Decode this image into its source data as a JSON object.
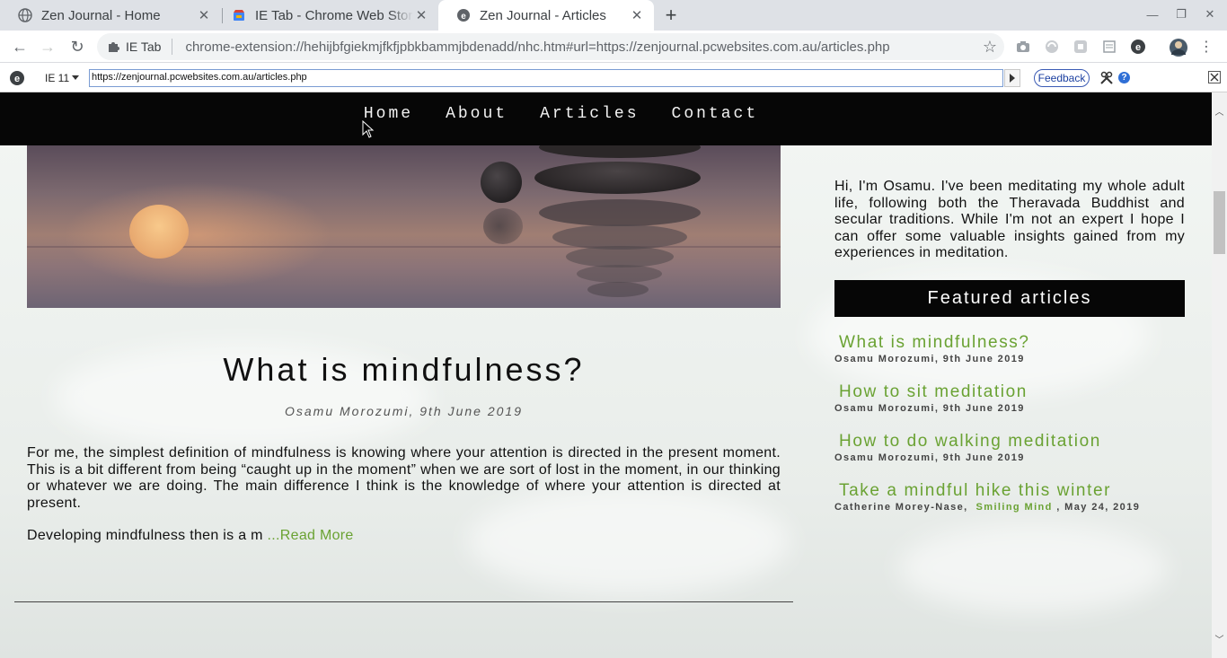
{
  "browser": {
    "tabs": [
      {
        "title": "Zen Journal - Home",
        "active": false
      },
      {
        "title": "IE Tab - Chrome Web Store",
        "active": false
      },
      {
        "title": "Zen Journal - Articles",
        "active": true
      }
    ],
    "new_tab": "+",
    "omnibox": {
      "extension_label": "IE Tab",
      "url": "chrome-extension://hehijbfgiekmjfkfjpbkbammjbdenadd/nhc.htm#url=https://zenjournal.pcwebsites.com.au/articles.php"
    }
  },
  "ietab": {
    "version": "IE 11",
    "url": "https://zenjournal.pcwebsites.com.au/articles.php",
    "feedback_label": "Feedback",
    "help_label": "?"
  },
  "site": {
    "nav": [
      "Home",
      "About",
      "Articles",
      "Contact"
    ],
    "post": {
      "title": "What is mindfulness?",
      "meta": "Osamu Morozumi, 9th June 2019",
      "body": "For me, the simplest definition of mindfulness is knowing where your attention is directed in the present moment. This is a bit different from being “caught up in the moment” when we are sort of lost in the moment, in our thinking or whatever we are doing. The main difference I think is the knowledge of where your attention is directed at present.",
      "excerpt": "Developing mindfulness then is a m ",
      "read_more": "...Read More"
    },
    "sidebar": {
      "bio": "Hi, I'm Osamu. I've been meditating my whole adult life, following both the Theravada Buddhist and secular traditions. While I'm not an expert I hope I can offer some valuable insights gained from my experiences in meditation.",
      "featured_heading": "Featured articles",
      "featured": [
        {
          "title": "What is mindfulness?",
          "meta": "Osamu Morozumi, 9th June 2019"
        },
        {
          "title": "How to sit meditation",
          "meta": "Osamu Morozumi, 9th June 2019"
        },
        {
          "title": "How to do walking meditation",
          "meta": "Osamu Morozumi, 9th June 2019"
        },
        {
          "title": "Take a mindful hike this winter",
          "meta_author": "Catherine Morey-Nase,",
          "meta_source": "Smiling Mind",
          "meta_date": ", May 24, 2019"
        }
      ]
    }
  },
  "colors": {
    "accent_green": "#6aa233",
    "nav_bg": "#060606",
    "tabstrip_bg": "#dee1e6"
  },
  "icons": [
    "globe-icon",
    "chrome-store-icon",
    "ie-tab-icon",
    "close-icon",
    "plus-icon",
    "back-icon",
    "forward-icon",
    "reload-icon",
    "puzzle-icon",
    "star-icon",
    "camera-icon",
    "extension-icon",
    "profile-avatar",
    "menu-icon",
    "tools-icon",
    "help-icon"
  ]
}
